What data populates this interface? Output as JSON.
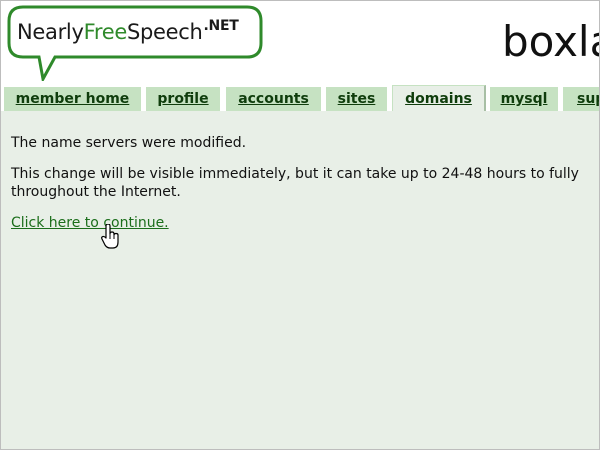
{
  "logo": {
    "part1": "Nearly",
    "part2": "Free",
    "part3": "Speech",
    "suffix": ".NET"
  },
  "site_title": "boxla",
  "tabs": [
    {
      "label": "member home"
    },
    {
      "label": "profile"
    },
    {
      "label": "accounts"
    },
    {
      "label": "sites"
    },
    {
      "label": "domains",
      "active": true
    },
    {
      "label": "mysql"
    },
    {
      "label": "sup"
    }
  ],
  "message": {
    "line1": "The name servers were modified.",
    "line2": "This change will be visible immediately, but it can take up to 24-48 hours to fully",
    "line3": "throughout the Internet.",
    "link": "Click here to continue."
  },
  "colors": {
    "tab_bg": "#c6e2c2",
    "content_bg": "#e8efe7",
    "link": "#1b6e1b",
    "logo_green": "#2f8a2b"
  }
}
